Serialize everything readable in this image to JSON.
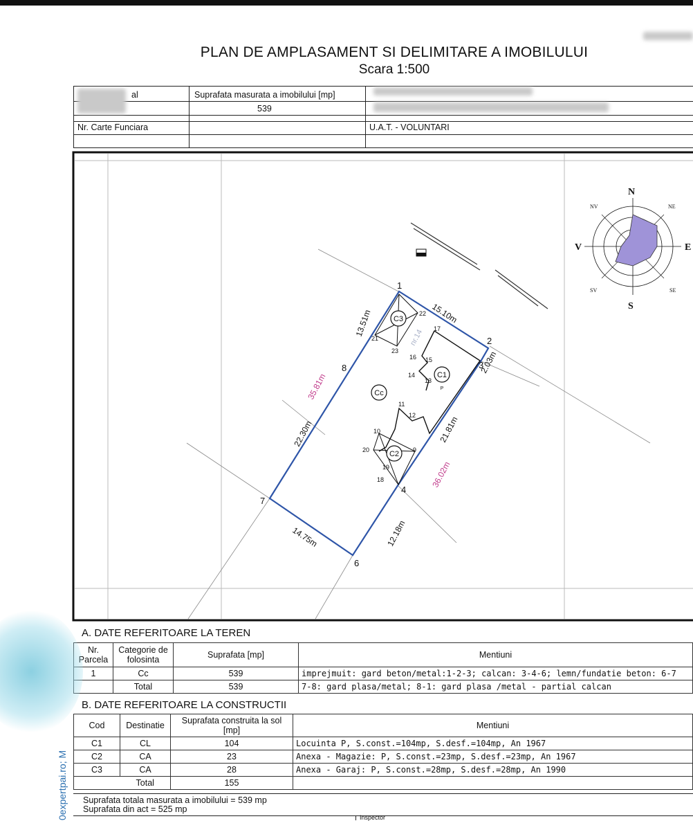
{
  "title": "PLAN DE AMPLASAMENT SI DELIMITARE A IMOBILULUI",
  "scale": "Scara 1:500",
  "header": {
    "cad_label_partial": "al",
    "area_label": "Suprafata masurata a imobilului [mp]",
    "area_value": "539",
    "cf_label": "Nr. Carte Funciara",
    "uat_label": "U.A.T. - VOLUNTARI"
  },
  "plan": {
    "points": [
      "1",
      "2",
      "3",
      "4",
      "6",
      "7",
      "8",
      "9",
      "10",
      "11",
      "12",
      "13",
      "14",
      "15",
      "16",
      "17",
      "18",
      "19",
      "20",
      "21",
      "22",
      "23"
    ],
    "dimensions": [
      "13.51m",
      "15.10m",
      "2.03m",
      "21.81m",
      "12.18m",
      "14.75m",
      "22.30m"
    ],
    "pink_dimensions": [
      "35.81m",
      "36.02m"
    ],
    "street_label": "nr.14",
    "building_labels": [
      "C3",
      "C1",
      "Cc",
      "C2"
    ],
    "c1_floor": "P",
    "compass": {
      "N": "N",
      "S": "S",
      "E": "E",
      "V": "V",
      "NE": "NE",
      "NV": "NV",
      "SE": "SE",
      "SV": "SV"
    }
  },
  "section_a": {
    "title": "A. DATE REFERITOARE LA TEREN",
    "headers": [
      "Nr. Parcela",
      "Categorie de folosinta",
      "Suprafata [mp]",
      "Mentiuni"
    ],
    "rows": [
      [
        "1",
        "Cc",
        "539",
        "imprejmuit: gard beton/metal:1-2-3; calcan: 3-4-6; lemn/fundatie beton: 6-7"
      ],
      [
        "",
        "Total",
        "539",
        "7-8: gard plasa/metal; 8-1: gard plasa /metal - partial calcan"
      ]
    ]
  },
  "section_b": {
    "title": "B. DATE REFERITOARE LA CONSTRUCTII",
    "headers": [
      "Cod",
      "Destinatie",
      "Suprafata construita la sol [mp]",
      "Mentiuni"
    ],
    "rows": [
      [
        "C1",
        "CL",
        "104",
        "Locuinta P, S.const.=104mp, S.desf.=104mp, An 1967"
      ],
      [
        "C2",
        "CA",
        "23",
        "Anexa - Magazie: P, S.const.=23mp, S.desf.=23mp, An 1967"
      ],
      [
        "C3",
        "CA",
        "28",
        "Anexa - Garaj: P, S.const.=28mp, S.desf.=28mp, An 1990"
      ]
    ],
    "total_label": "Total",
    "total_value": "155"
  },
  "footer": {
    "line1": "Suprafata totala masurata a imobilului = 539 mp",
    "line2": "Suprafata din act = 525 mp",
    "inspector": "Inspector"
  },
  "watermark": "0expertpai.ro; M"
}
